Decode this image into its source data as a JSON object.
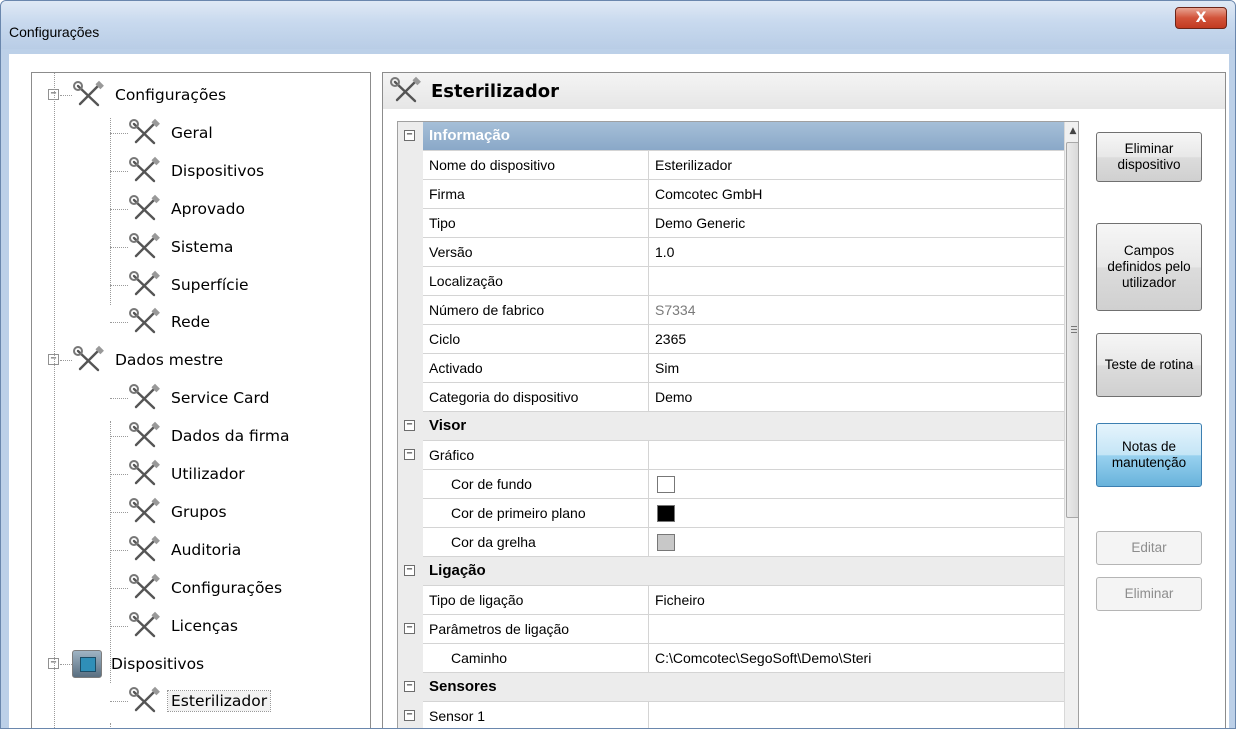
{
  "window": {
    "title": "Configurações",
    "close_label": "X"
  },
  "tree": {
    "items": [
      {
        "label": "Configurações",
        "level": 0,
        "expanded": true,
        "icon": "tools-icon"
      },
      {
        "label": "Geral",
        "level": 1,
        "icon": "tools-icon"
      },
      {
        "label": "Dispositivos",
        "level": 1,
        "icon": "tools-icon"
      },
      {
        "label": "Aprovado",
        "level": 1,
        "icon": "tools-icon"
      },
      {
        "label": "Sistema",
        "level": 1,
        "icon": "tools-icon"
      },
      {
        "label": "Superfície",
        "level": 1,
        "icon": "tools-icon"
      },
      {
        "label": "Rede",
        "level": 1,
        "icon": "tools-icon"
      },
      {
        "label": "Dados mestre",
        "level": 0,
        "expanded": true,
        "icon": "tools-icon"
      },
      {
        "label": "Service Card",
        "level": 1,
        "icon": "tools-icon"
      },
      {
        "label": "Dados da firma",
        "level": 1,
        "icon": "tools-icon"
      },
      {
        "label": "Utilizador",
        "level": 1,
        "icon": "tools-icon"
      },
      {
        "label": "Grupos",
        "level": 1,
        "icon": "tools-icon"
      },
      {
        "label": "Auditoria",
        "level": 1,
        "icon": "tools-icon"
      },
      {
        "label": "Configurações",
        "level": 1,
        "icon": "tools-icon"
      },
      {
        "label": "Licenças",
        "level": 1,
        "icon": "tools-icon"
      },
      {
        "label": "Dispositivos",
        "level": 0,
        "expanded": true,
        "icon": "device-icon"
      },
      {
        "label": "Esterilizador",
        "level": 1,
        "icon": "tools-icon",
        "selected": true
      }
    ]
  },
  "panel": {
    "title": "Esterilizador",
    "icon": "tools-icon"
  },
  "grid": {
    "rows": [
      {
        "type": "category",
        "name": "Informação",
        "highlight": true,
        "collapsible": true
      },
      {
        "type": "prop",
        "name": "Nome do dispositivo",
        "value": "Esterilizador"
      },
      {
        "type": "prop",
        "name": "Firma",
        "value": "Comcotec GmbH"
      },
      {
        "type": "prop",
        "name": "Tipo",
        "value": "Demo Generic"
      },
      {
        "type": "prop",
        "name": "Versão",
        "value": "1.0"
      },
      {
        "type": "prop",
        "name": "Localização",
        "value": ""
      },
      {
        "type": "prop",
        "name": "Número de fabrico",
        "value": "S7334",
        "greyed": true
      },
      {
        "type": "prop",
        "name": "Ciclo",
        "value": "2365"
      },
      {
        "type": "prop",
        "name": "Activado",
        "value": "Sim"
      },
      {
        "type": "prop",
        "name": "Categoria do dispositivo",
        "value": "Demo"
      },
      {
        "type": "category",
        "name": "Visor",
        "collapsible": true
      },
      {
        "type": "prop",
        "name": "Gráfico",
        "value": "",
        "collapsible": true
      },
      {
        "type": "color",
        "name": "Cor de fundo",
        "color": "#ffffff",
        "indent": true
      },
      {
        "type": "color",
        "name": "Cor de primeiro plano",
        "color": "#000000",
        "indent": true
      },
      {
        "type": "color",
        "name": "Cor da grelha",
        "color": "#c8c8c8",
        "indent": true
      },
      {
        "type": "category",
        "name": "Ligação",
        "collapsible": true
      },
      {
        "type": "prop",
        "name": "Tipo de ligação",
        "value": "Ficheiro"
      },
      {
        "type": "prop",
        "name": "Parâmetros de ligação",
        "value": "",
        "collapsible": true
      },
      {
        "type": "prop",
        "name": "Caminho",
        "value": "C:\\Comcotec\\SegoSoft\\Demo\\Steri",
        "indent": true
      },
      {
        "type": "category",
        "name": "Sensores",
        "collapsible": true
      },
      {
        "type": "prop",
        "name": "Sensor 1",
        "value": "",
        "collapsible": true
      },
      {
        "type": "prop",
        "name": "",
        "value": ""
      }
    ]
  },
  "buttons": [
    {
      "label": "Eliminar dispositivo",
      "state": "normal"
    },
    {
      "label": "Campos definidos pelo utilizador",
      "state": "normal"
    },
    {
      "label": "Teste de rotina",
      "state": "normal"
    },
    {
      "label": "Notas de manutenção",
      "state": "active"
    },
    {
      "label": "Editar",
      "state": "disabled"
    },
    {
      "label": "Eliminar",
      "state": "disabled"
    }
  ],
  "colors": {
    "accent": "#68b3db",
    "category_highlight": "#8aa8c8",
    "window_frame": "#bcd0e8"
  }
}
